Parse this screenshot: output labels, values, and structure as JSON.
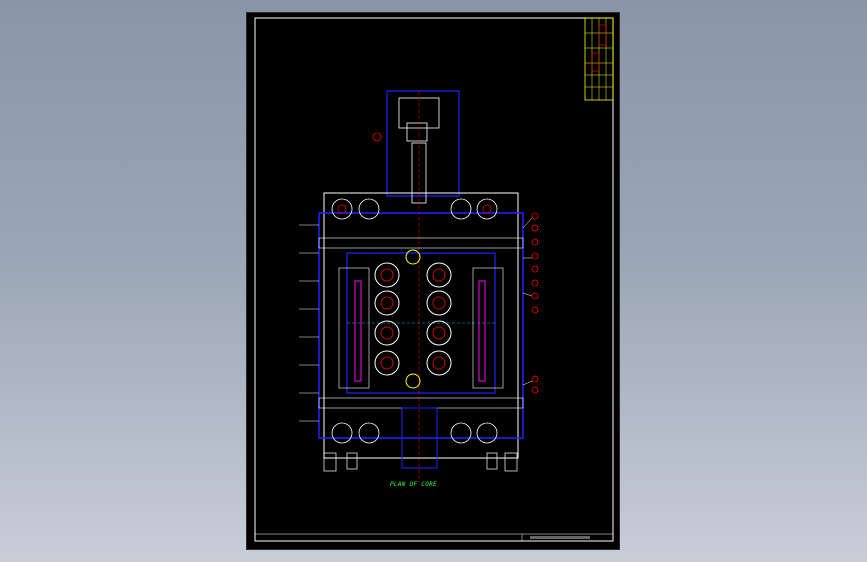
{
  "drawing": {
    "note_label": "PLAN OF CORE",
    "colors": {
      "background": "#000000",
      "border": "#ffffff",
      "title_block": "#ffff00",
      "structure": "#2222ff",
      "outline": "#ffffff",
      "highlight": "#ff0000",
      "accent": "#ff00ff",
      "note": "#39ff39",
      "secondary": "#00ffff"
    }
  }
}
